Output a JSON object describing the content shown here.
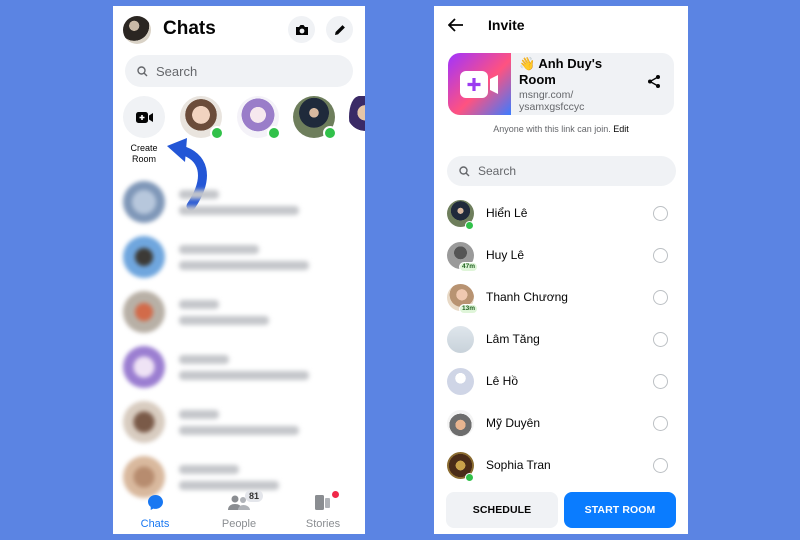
{
  "background_color": "#5b84e3",
  "left_panel": {
    "header": {
      "title": "Chats",
      "camera_icon": "camera-icon",
      "compose_icon": "pencil-icon"
    },
    "search": {
      "placeholder": "Search"
    },
    "stories": {
      "create_room_label": "Create Room",
      "avatars": [
        {
          "name": "contact-1",
          "online": true
        },
        {
          "name": "contact-2",
          "online": true
        },
        {
          "name": "contact-3",
          "online": true
        },
        {
          "name": "contact-4",
          "online": false
        }
      ]
    },
    "chats_blurred": true,
    "chat_rows": 6,
    "tabs": [
      {
        "label": "Chats",
        "active": true
      },
      {
        "label": "People",
        "badge": "81"
      },
      {
        "label": "Stories",
        "has_dot": true
      }
    ],
    "accent_color": "#1877f2"
  },
  "right_panel": {
    "header": {
      "title": "Invite"
    },
    "room": {
      "emoji": "👋",
      "name": "Anh Duy's Room",
      "link_line1": "msngr.com/",
      "link_line2": "ysamxgsfccyc",
      "note": "Anyone with this link can join.",
      "edit_label": "Edit"
    },
    "search": {
      "placeholder": "Search"
    },
    "contacts": [
      {
        "name": "Hiển Lê",
        "online": true
      },
      {
        "name": "Huy Lê",
        "last_active": "47m"
      },
      {
        "name": "Thanh Chương",
        "last_active": "13m"
      },
      {
        "name": "Lâm Tăng"
      },
      {
        "name": "Lê Hồ",
        "default_avatar": true
      },
      {
        "name": "Mỹ Duyên"
      },
      {
        "name": "Sophia Tran",
        "online": true
      }
    ],
    "buttons": {
      "schedule": "SCHEDULE",
      "start": "START ROOM"
    },
    "primary_color": "#0a7cff"
  }
}
